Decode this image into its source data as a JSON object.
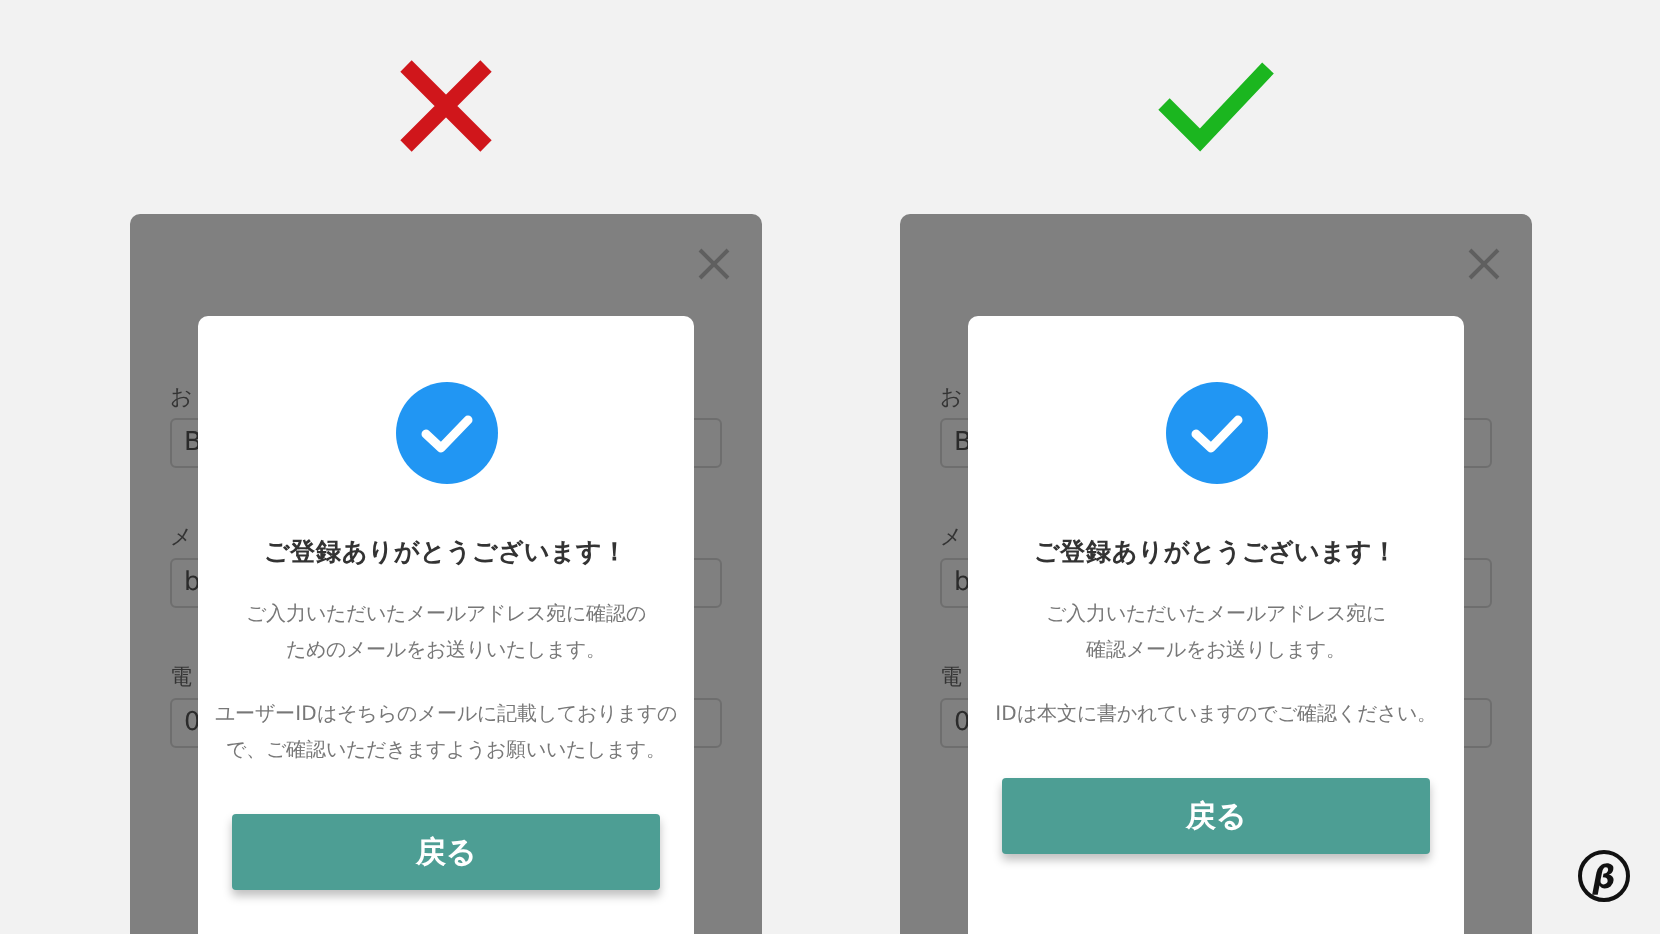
{
  "examples": [
    {
      "kind": "cross",
      "form": {
        "fields": [
          {
            "label": "お",
            "value": "B"
          },
          {
            "label": "メ",
            "value": "b"
          },
          {
            "label": "電",
            "value": "0"
          }
        ]
      },
      "dialog": {
        "title": "ご登録ありがとうございます！",
        "paragraphs": [
          [
            "ご入力いただいたメールアドレス宛に確認の",
            "ためのメールをお送りいたします。"
          ],
          [
            "ユーザーIDはそちらのメールに記載しておりますの",
            "で、ご確認いただきますようお願いいたします。"
          ]
        ],
        "button": "戻る"
      }
    },
    {
      "kind": "check",
      "form": {
        "fields": [
          {
            "label": "お",
            "value": "B"
          },
          {
            "label": "メ",
            "value": "b"
          },
          {
            "label": "電",
            "value": "0"
          }
        ]
      },
      "dialog": {
        "title": "ご登録ありがとうございます！",
        "paragraphs": [
          [
            "ご入力いただいたメールアドレス宛に",
            "確認メールをお送りします。"
          ],
          [
            "IDは本文に書かれていますのでご確認ください。"
          ]
        ],
        "button": "戻る"
      }
    }
  ],
  "logo": {
    "text": "β"
  }
}
